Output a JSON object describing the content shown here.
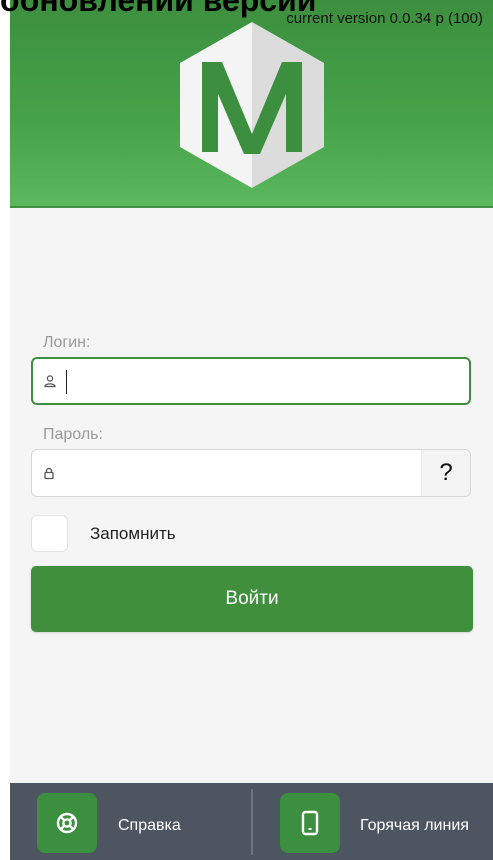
{
  "overlay": {
    "title": "обновлений версий",
    "version": "current version 0.0.34 p (100)"
  },
  "logo": {
    "letter": "M"
  },
  "login": {
    "label": "Логин:",
    "value": "",
    "placeholder": ""
  },
  "password": {
    "label": "Пароль:",
    "value": "",
    "placeholder": "",
    "help_label": "?"
  },
  "remember": {
    "label": "Запомнить",
    "checked": false
  },
  "submit": {
    "label": "Войти"
  },
  "bottom_nav": {
    "help": {
      "label": "Справка",
      "icon": "lifebuoy-icon"
    },
    "hotline": {
      "label": "Горячая линия",
      "icon": "phone-icon"
    }
  },
  "colors": {
    "brand_green": "#3c8f3e",
    "bottom_bar": "#4d5560"
  }
}
